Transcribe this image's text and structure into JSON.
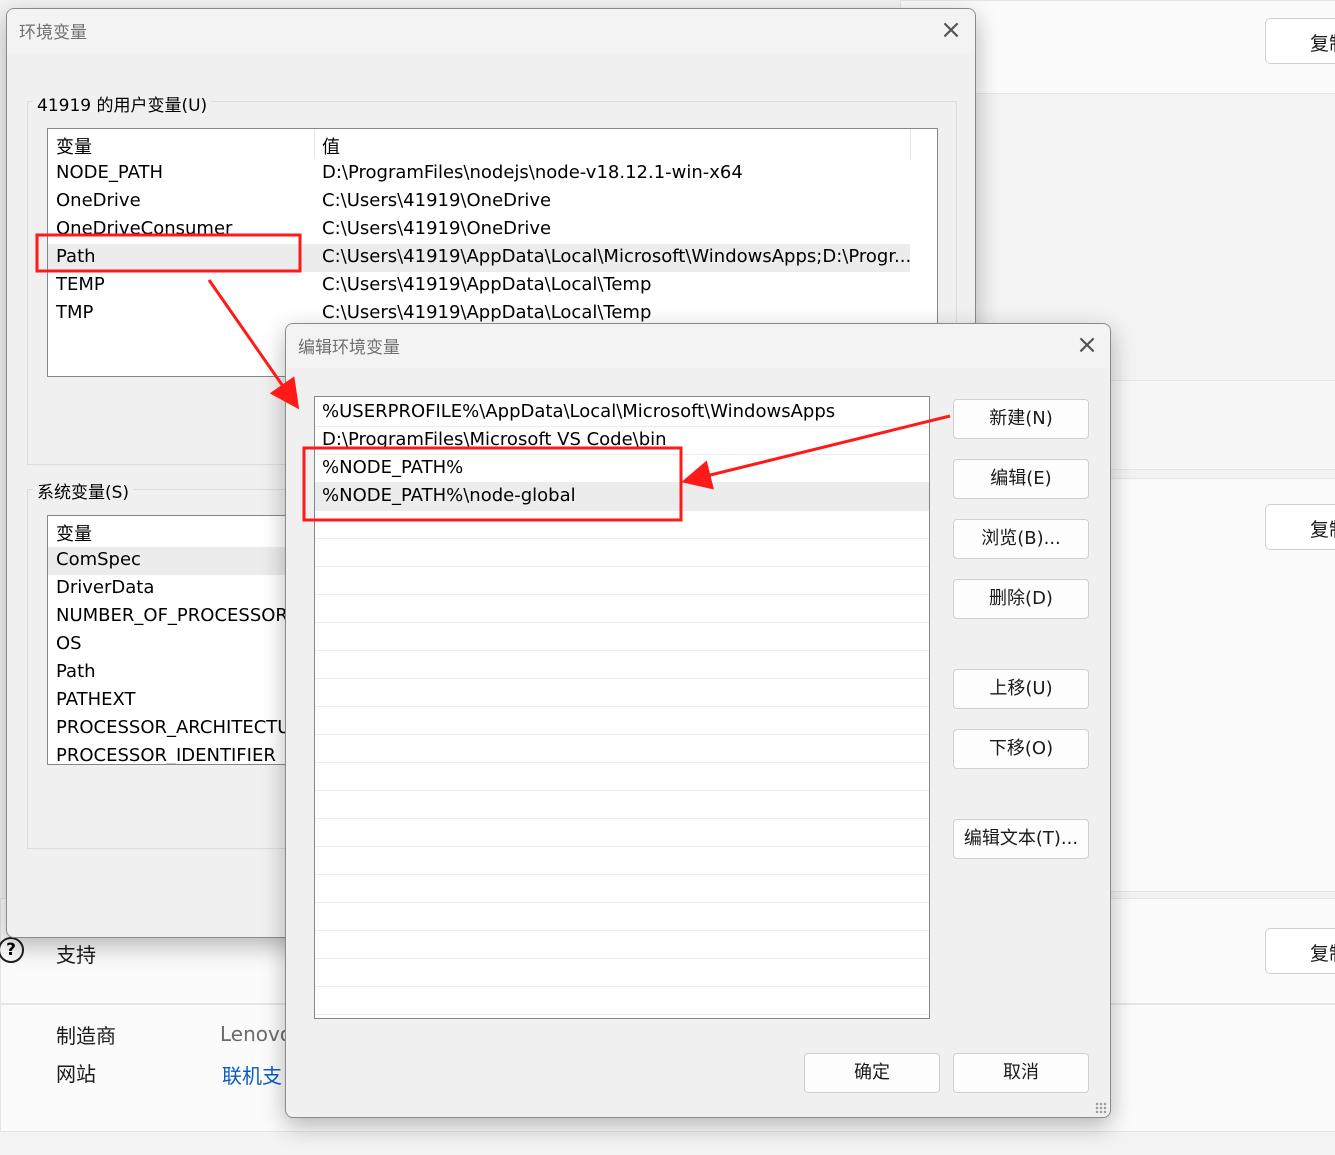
{
  "background": {
    "copy_button_label": "复制",
    "support_label": "支持",
    "support_icon": "?",
    "manufacturer_label": "制造商",
    "manufacturer_value": "Lenovo",
    "website_label": "网站",
    "website_value": "联机支"
  },
  "env_dialog": {
    "title": "环境变量",
    "close_icon": "×",
    "user_group_label": "41919 的用户变量(U)",
    "system_group_label": "系统变量(S)",
    "columns": {
      "variable": "变量",
      "value": "值"
    },
    "user_vars": [
      {
        "name": "NODE_PATH",
        "value": "D:\\ProgramFiles\\nodejs\\node-v18.12.1-win-x64"
      },
      {
        "name": "OneDrive",
        "value": "C:\\Users\\41919\\OneDrive"
      },
      {
        "name": "OneDriveConsumer",
        "value": "C:\\Users\\41919\\OneDrive"
      },
      {
        "name": "Path",
        "value": "C:\\Users\\41919\\AppData\\Local\\Microsoft\\WindowsApps;D:\\Progr..."
      },
      {
        "name": "TEMP",
        "value": "C:\\Users\\41919\\AppData\\Local\\Temp"
      },
      {
        "name": "TMP",
        "value": "C:\\Users\\41919\\AppData\\Local\\Temp"
      }
    ],
    "system_vars": [
      {
        "name": "ComSpec"
      },
      {
        "name": "DriverData"
      },
      {
        "name": "NUMBER_OF_PROCESSORS"
      },
      {
        "name": "OS"
      },
      {
        "name": "Path"
      },
      {
        "name": "PATHEXT"
      },
      {
        "name": "PROCESSOR_ARCHITECTURE"
      },
      {
        "name": "PROCESSOR_IDENTIFIER"
      }
    ]
  },
  "edit_dialog": {
    "title": "编辑环境变量",
    "close_icon": "×",
    "entries": [
      "%USERPROFILE%\\AppData\\Local\\Microsoft\\WindowsApps",
      "D:\\ProgramFiles\\Microsoft VS Code\\bin",
      "%NODE_PATH%",
      "%NODE_PATH%\\node-global"
    ],
    "buttons": {
      "new": "新建(N)",
      "edit": "编辑(E)",
      "browse": "浏览(B)...",
      "delete": "删除(D)",
      "move_up": "上移(U)",
      "move_down": "下移(O)",
      "edit_text": "编辑文本(T)...",
      "ok": "确定",
      "cancel": "取消"
    }
  },
  "annotation_color": "#ff1a1a"
}
